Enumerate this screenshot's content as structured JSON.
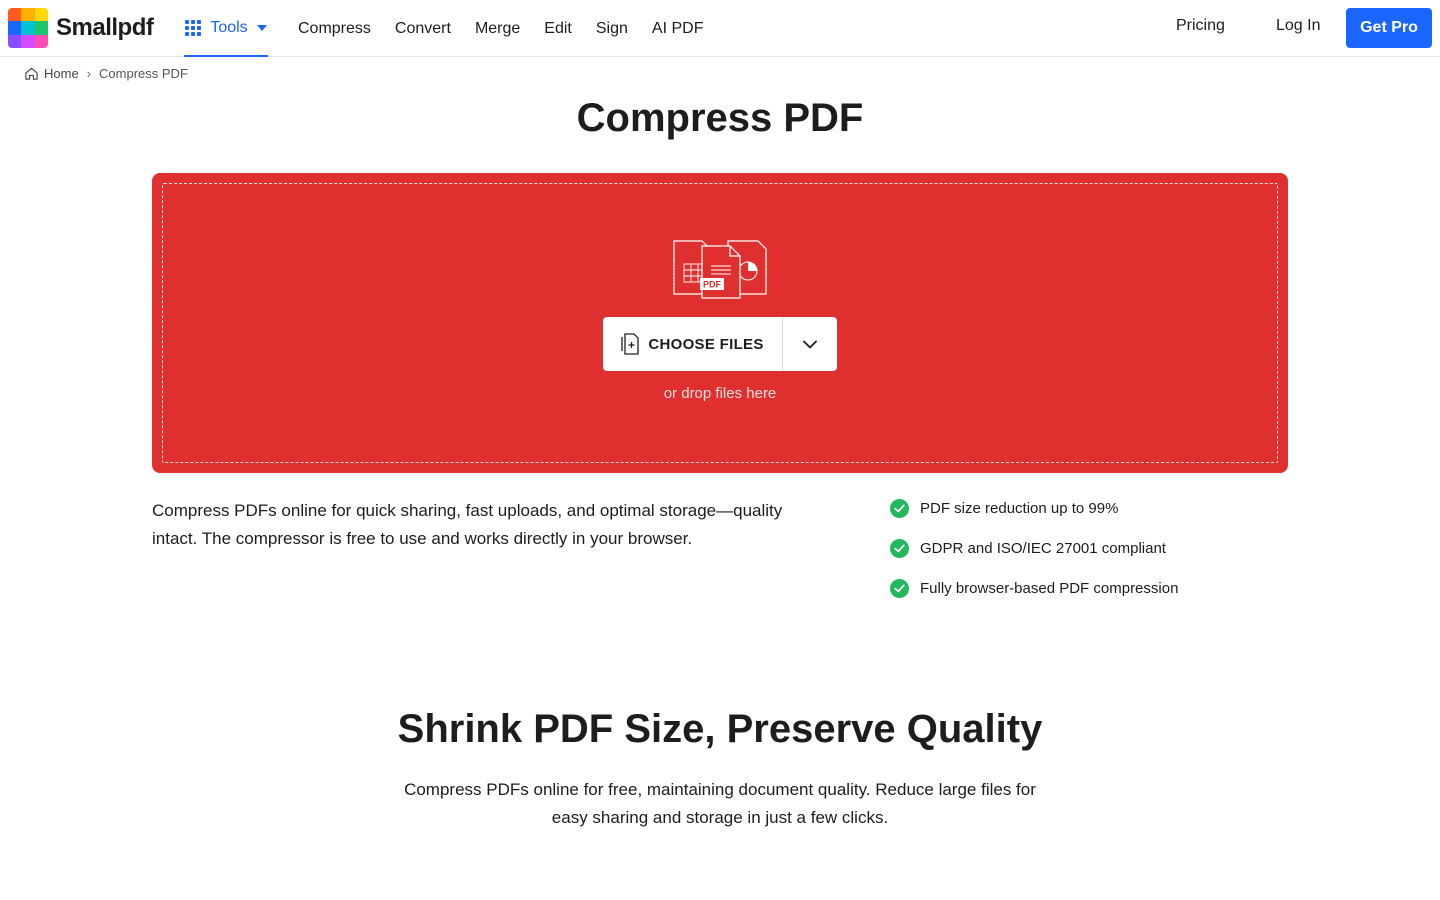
{
  "header": {
    "logo_text": "Smallpdf",
    "tools_label": "Tools",
    "nav": [
      "Compress",
      "Convert",
      "Merge",
      "Edit",
      "Sign",
      "AI PDF"
    ],
    "pricing": "Pricing",
    "login": "Log In",
    "get_pro": "Get Pro"
  },
  "breadcrumb": {
    "home": "Home",
    "separator": "›",
    "current": "Compress PDF"
  },
  "page_title": "Compress PDF",
  "dropzone": {
    "choose_files": "CHOOSE FILES",
    "drop_hint": "or drop files here",
    "illustration_badge": "PDF",
    "background_color": "#df2f2f"
  },
  "description": "Compress PDFs online for quick sharing, fast uploads, and optimal storage—quality intact. The compressor is free to use and works directly in your browser.",
  "features": [
    "PDF size reduction up to 99%",
    "GDPR and ISO/IEC 27001 compliant",
    "Fully browser-based PDF compression"
  ],
  "section2": {
    "title": "Shrink PDF Size, Preserve Quality",
    "text": "Compress PDFs online for free, maintaining document quality. Reduce large files for easy sharing and storage in just a few clicks."
  },
  "colors": {
    "accent": "#1a66ff",
    "check": "#1fb85a"
  },
  "icons": {
    "tools": "grid-icon",
    "home": "home-icon",
    "choose": "file-add-icon",
    "dropdown": "chevron-down-icon",
    "feature": "check-circle-icon"
  }
}
